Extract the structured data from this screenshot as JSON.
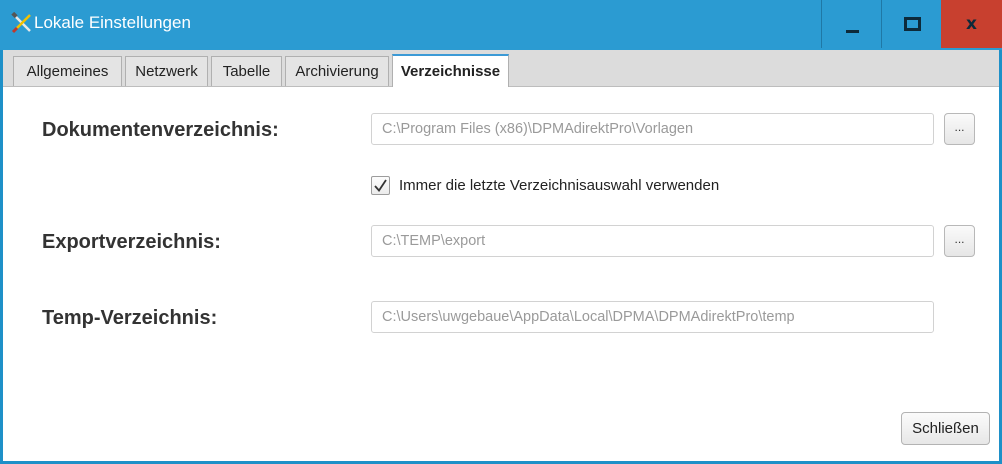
{
  "window": {
    "title": "Lokale Einstellungen",
    "icons": {
      "app": "tools-icon",
      "minimize": "minimize-icon",
      "maximize": "maximize-icon",
      "close": "close-icon"
    },
    "close_glyph": "x"
  },
  "tabs": [
    {
      "label": "Allgemeines",
      "active": false
    },
    {
      "label": "Netzwerk",
      "active": false
    },
    {
      "label": "Tabelle",
      "active": false
    },
    {
      "label": "Archivierung",
      "active": false
    },
    {
      "label": "Verzeichnisse",
      "active": true
    }
  ],
  "form": {
    "documents": {
      "label": "Dokumentenverzeichnis:",
      "value": "C:\\Program Files (x86)\\DPMAdirektPro\\Vorlagen",
      "browse_label": "..."
    },
    "remember": {
      "checked": true,
      "label": "Immer die letzte Verzeichnisauswahl verwenden"
    },
    "export": {
      "label": "Exportverzeichnis:",
      "value": "C:\\TEMP\\export",
      "browse_label": "..."
    },
    "temp": {
      "label": "Temp-Verzeichnis:",
      "value": "C:\\Users\\uwgebaue\\AppData\\Local\\DPMA\\DPMAdirektPro\\temp"
    }
  },
  "footer": {
    "close_label": "Schließen"
  },
  "colors": {
    "titlebar": "#2b9bd2",
    "close_button": "#c8402f",
    "tab_accent": "#3c9ad6",
    "field_text": "#9a9a9a"
  }
}
